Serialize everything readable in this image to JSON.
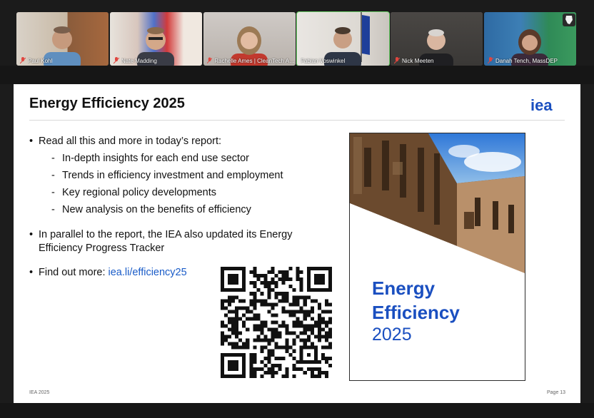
{
  "participants": [
    {
      "name": "Paul Kohl",
      "muted": true
    },
    {
      "name": "Nate Madding",
      "muted": true
    },
    {
      "name": "Rachelle Ames | CleanTech Allian...",
      "muted": true
    },
    {
      "name": "Fabian Voswinkel",
      "muted": false,
      "active": true
    },
    {
      "name": "Nick Meeten",
      "muted": true
    },
    {
      "name": "Danah Tench, MassDEP",
      "muted": true
    }
  ],
  "slide": {
    "title": "Energy Efficiency 2025",
    "logo_text": "iea",
    "bullets": {
      "b1": "Read all this and more in today’s report:",
      "sub": [
        "In-depth insights for each end use sector",
        "Trends in efficiency investment and employment",
        "Key regional policy developments",
        "New analysis on the benefits of efficiency"
      ],
      "b2_line1": "In parallel to the report, the IEA also updated its Energy",
      "b2_line2": "Efficiency Progress Tracker",
      "b3_prefix": "Find out more: ",
      "b3_link": "iea.li/efficiency25"
    },
    "cover": {
      "title_line1": "Energy",
      "title_line2": "Efficiency",
      "year": "2025"
    },
    "footer_left": "IEA 2025",
    "footer_right": "Page 13"
  },
  "colors": {
    "accent_blue": "#1a4fc0",
    "link_blue": "#1a5cc8",
    "active_tile_border": "#6ed36a",
    "muted_mic": "#e0463f"
  },
  "icons": [
    "mic-muted-icon",
    "mic-icon",
    "iea-logo",
    "qr-code"
  ]
}
